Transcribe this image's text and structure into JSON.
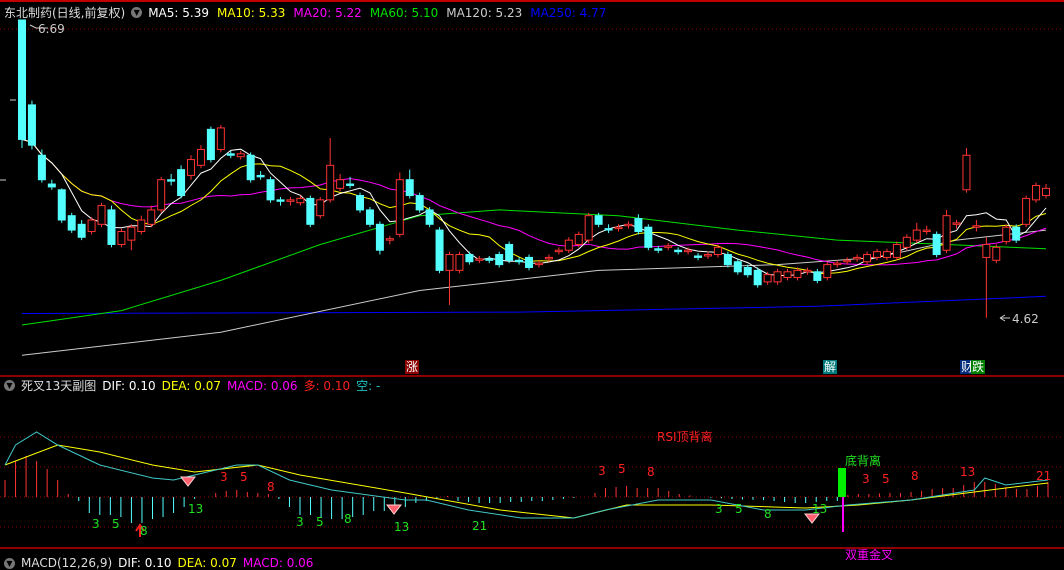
{
  "main_header": {
    "stock": "东北制药(日线,前复权)",
    "ma": [
      {
        "label": "MA5: 5.39",
        "color": "#ffffff"
      },
      {
        "label": "MA10: 5.33",
        "color": "#ffff00"
      },
      {
        "label": "MA20: 5.22",
        "color": "#ff00ff"
      },
      {
        "label": "MA60: 5.10",
        "color": "#00e000"
      },
      {
        "label": "MA120: 5.23",
        "color": "#cccccc"
      },
      {
        "label": "MA250: 4.77",
        "color": "#0000ff"
      }
    ]
  },
  "price_marks": {
    "high": "6.69",
    "low": "4.62"
  },
  "signals": {
    "zhang": "涨",
    "jie": "解",
    "cai": "财",
    "die": "跌"
  },
  "sub_header": {
    "title": "死叉13天副图",
    "dif": "DIF: 0.10",
    "dea": "DEA: 0.07",
    "macd": "MACD: 0.06",
    "duo": "多: 0.10",
    "kong": "空: -"
  },
  "bottom_header": {
    "title": "MACD(12,26,9)",
    "dif": "DIF: 0.10",
    "dea": "DEA: 0.07",
    "macd": "MACD: 0.06"
  },
  "sub_labels": {
    "rsi_top": "RSI顶背离",
    "bottom_div": "底背离",
    "double_gold": "双重金叉",
    "fib": [
      "3",
      "5",
      "8",
      "13",
      "3",
      "5",
      "8",
      "13",
      "21",
      "3",
      "5",
      "8",
      "13",
      "3",
      "5",
      "8",
      "3",
      "5",
      "8",
      "3",
      "5",
      "8",
      "13",
      "21"
    ]
  },
  "colors": {
    "up": "#ff3333",
    "down": "#54ffff",
    "grid": "#a00000"
  },
  "chart_data": {
    "type": "candlestick",
    "candles": [
      [
        6.69,
        5.86,
        6.69,
        5.8
      ],
      [
        6.1,
        5.82,
        6.13,
        5.79
      ],
      [
        5.75,
        5.58,
        5.79,
        5.56
      ],
      [
        5.55,
        5.53,
        5.58,
        5.51
      ],
      [
        5.51,
        5.3,
        5.52,
        5.28
      ],
      [
        5.33,
        5.23,
        5.35,
        5.21
      ],
      [
        5.27,
        5.18,
        5.3,
        5.16
      ],
      [
        5.22,
        5.3,
        5.32,
        5.2
      ],
      [
        5.27,
        5.4,
        5.42,
        5.25
      ],
      [
        5.37,
        5.13,
        5.4,
        5.11
      ],
      [
        5.13,
        5.22,
        5.24,
        5.11
      ],
      [
        5.16,
        5.25,
        5.27,
        5.09
      ],
      [
        5.22,
        5.3,
        5.33,
        5.2
      ],
      [
        5.27,
        5.37,
        5.4,
        5.25
      ],
      [
        5.37,
        5.58,
        5.6,
        5.35
      ],
      [
        5.58,
        5.57,
        5.62,
        5.54
      ],
      [
        5.65,
        5.47,
        5.68,
        5.45
      ],
      [
        5.61,
        5.72,
        5.75,
        5.58
      ],
      [
        5.68,
        5.79,
        5.82,
        5.66
      ],
      [
        5.93,
        5.72,
        5.95,
        5.7
      ],
      [
        5.79,
        5.94,
        5.96,
        5.77
      ],
      [
        5.76,
        5.75,
        5.78,
        5.73
      ],
      [
        5.74,
        5.76,
        5.78,
        5.72
      ],
      [
        5.75,
        5.58,
        5.77,
        5.56
      ],
      [
        5.61,
        5.6,
        5.64,
        5.58
      ],
      [
        5.58,
        5.44,
        5.6,
        5.42
      ],
      [
        5.44,
        5.43,
        5.46,
        5.4
      ],
      [
        5.43,
        5.44,
        5.46,
        5.4
      ],
      [
        5.42,
        5.45,
        5.47,
        5.4
      ],
      [
        5.45,
        5.27,
        5.47,
        5.25
      ],
      [
        5.33,
        5.44,
        5.46,
        5.31
      ],
      [
        5.44,
        5.68,
        5.87,
        5.42
      ],
      [
        5.52,
        5.58,
        5.62,
        5.5
      ],
      [
        5.55,
        5.54,
        5.6,
        5.52
      ],
      [
        5.47,
        5.37,
        5.49,
        5.35
      ],
      [
        5.37,
        5.27,
        5.39,
        5.25
      ],
      [
        5.27,
        5.09,
        5.29,
        5.06
      ],
      [
        5.16,
        5.17,
        5.19,
        5.13
      ],
      [
        5.2,
        5.58,
        5.63,
        5.18
      ],
      [
        5.58,
        5.47,
        5.65,
        5.45
      ],
      [
        5.47,
        5.37,
        5.49,
        5.35
      ],
      [
        5.37,
        5.27,
        5.39,
        5.25
      ],
      [
        5.23,
        4.95,
        5.25,
        4.93
      ],
      [
        4.95,
        5.06,
        5.08,
        4.71
      ],
      [
        4.95,
        5.06,
        5.08,
        4.93
      ],
      [
        5.06,
        5.01,
        5.08,
        4.99
      ],
      [
        5.02,
        5.03,
        5.05,
        5.0
      ],
      [
        5.03,
        5.02,
        5.05,
        5.0
      ],
      [
        5.06,
        4.99,
        5.08,
        4.97
      ],
      [
        5.13,
        5.02,
        5.15,
        5.0
      ],
      [
        5.02,
        5.01,
        5.04,
        4.99
      ],
      [
        5.04,
        4.97,
        5.06,
        4.95
      ],
      [
        4.99,
        5.0,
        5.02,
        4.97
      ],
      [
        5.03,
        5.04,
        5.06,
        5.01
      ],
      [
        5.08,
        5.09,
        5.11,
        5.06
      ],
      [
        5.09,
        5.16,
        5.18,
        5.07
      ],
      [
        5.13,
        5.2,
        5.22,
        5.11
      ],
      [
        5.16,
        5.33,
        5.35,
        5.14
      ],
      [
        5.33,
        5.27,
        5.35,
        5.25
      ],
      [
        5.24,
        5.23,
        5.27,
        5.21
      ],
      [
        5.24,
        5.25,
        5.27,
        5.22
      ],
      [
        5.26,
        5.27,
        5.29,
        5.24
      ],
      [
        5.31,
        5.22,
        5.34,
        5.2
      ],
      [
        5.25,
        5.11,
        5.27,
        5.09
      ],
      [
        5.1,
        5.09,
        5.12,
        5.07
      ],
      [
        5.11,
        5.12,
        5.14,
        5.09
      ],
      [
        5.09,
        5.08,
        5.11,
        5.06
      ],
      [
        5.08,
        5.09,
        5.11,
        5.06
      ],
      [
        5.05,
        5.04,
        5.07,
        5.02
      ],
      [
        5.05,
        5.06,
        5.08,
        5.03
      ],
      [
        5.06,
        5.11,
        5.13,
        5.04
      ],
      [
        5.06,
        4.99,
        5.08,
        4.97
      ],
      [
        5.01,
        4.94,
        5.03,
        4.92
      ],
      [
        4.97,
        4.92,
        4.99,
        4.9
      ],
      [
        4.95,
        4.85,
        4.97,
        4.83
      ],
      [
        4.87,
        4.92,
        4.94,
        4.85
      ],
      [
        4.87,
        4.94,
        4.96,
        4.85
      ],
      [
        4.9,
        4.94,
        4.96,
        4.88
      ],
      [
        4.9,
        4.95,
        4.97,
        4.88
      ],
      [
        4.94,
        4.95,
        4.97,
        4.92
      ],
      [
        4.94,
        4.88,
        4.96,
        4.86
      ],
      [
        4.9,
        4.99,
        5.01,
        4.88
      ],
      [
        4.99,
        5.0,
        5.02,
        4.97
      ],
      [
        5.01,
        5.02,
        5.04,
        4.99
      ],
      [
        5.03,
        5.04,
        5.06,
        5.01
      ],
      [
        5.01,
        5.06,
        5.08,
        4.99
      ],
      [
        5.04,
        5.08,
        5.1,
        5.02
      ],
      [
        5.04,
        5.08,
        5.1,
        5.02
      ],
      [
        5.04,
        5.13,
        5.15,
        5.02
      ],
      [
        5.11,
        5.18,
        5.2,
        5.09
      ],
      [
        5.16,
        5.23,
        5.28,
        5.14
      ],
      [
        5.22,
        5.23,
        5.26,
        5.2
      ],
      [
        5.2,
        5.06,
        5.22,
        5.04
      ],
      [
        5.09,
        5.33,
        5.37,
        5.07
      ],
      [
        5.27,
        5.28,
        5.3,
        5.24
      ],
      [
        5.51,
        5.75,
        5.8,
        5.49
      ],
      [
        5.25,
        5.26,
        5.3,
        5.22
      ],
      [
        5.04,
        5.13,
        5.18,
        4.62
      ],
      [
        5.02,
        5.11,
        5.13,
        5.0
      ],
      [
        5.15,
        5.25,
        5.27,
        5.13
      ],
      [
        5.25,
        5.16,
        5.27,
        5.14
      ],
      [
        5.27,
        5.45,
        5.47,
        5.25
      ],
      [
        5.44,
        5.54,
        5.56,
        5.42
      ],
      [
        5.47,
        5.52,
        5.55,
        5.45
      ]
    ],
    "ma_long": {
      "MA60": [
        [
          0,
          4.57
        ],
        [
          10,
          4.67
        ],
        [
          20,
          4.88
        ],
        [
          30,
          5.13
        ],
        [
          40,
          5.33
        ],
        [
          48,
          5.37
        ],
        [
          60,
          5.33
        ],
        [
          72,
          5.23
        ],
        [
          82,
          5.16
        ],
        [
          93,
          5.13
        ],
        [
          103,
          5.1
        ]
      ],
      "MA120": [
        [
          0,
          4.36
        ],
        [
          20,
          4.52
        ],
        [
          40,
          4.81
        ],
        [
          58,
          4.95
        ],
        [
          76,
          4.99
        ],
        [
          86,
          5.04
        ],
        [
          94,
          5.16
        ],
        [
          103,
          5.23
        ]
      ],
      "MA250": [
        [
          0,
          4.65
        ],
        [
          50,
          4.66
        ],
        [
          80,
          4.7
        ],
        [
          103,
          4.77
        ]
      ]
    },
    "price_range": [
      4.36,
      6.69
    ],
    "macd": {
      "hist": [
        0.085,
        0.18,
        0.205,
        0.18,
        0.14,
        0.085,
        0.015,
        -0.02,
        -0.08,
        -0.09,
        -0.09,
        -0.1,
        -0.13,
        -0.13,
        -0.11,
        -0.1,
        -0.08,
        -0.05,
        -0.01,
        0.0,
        0.02,
        0.03,
        0.035,
        0.025,
        0.02,
        0.015,
        -0.01,
        -0.05,
        -0.09,
        -0.09,
        -0.1,
        -0.11,
        -0.11,
        -0.1,
        -0.09,
        -0.07,
        -0.07,
        -0.06,
        -0.05,
        -0.03,
        -0.02,
        -0.01,
        0.005,
        -0.02,
        -0.025,
        -0.03,
        -0.03,
        -0.03,
        -0.025,
        -0.025,
        -0.02,
        -0.02,
        -0.015,
        -0.01,
        -0.005,
        0.0,
        0.02,
        0.045,
        0.05,
        0.055,
        0.045,
        0.045,
        0.045,
        0.03,
        0.015,
        0.008,
        0.0,
        -0.004,
        -0.006,
        -0.01,
        -0.012,
        -0.014,
        -0.016,
        -0.02,
        -0.025,
        -0.03,
        -0.03,
        -0.025,
        -0.02,
        -0.02,
        0.01,
        0.015,
        0.015,
        0.018,
        0.02,
        0.02,
        0.025,
        0.03,
        0.04,
        0.045,
        0.045,
        0.06,
        0.075,
        0.075,
        0.065,
        0.05,
        0.04,
        0.04,
        0.055,
        0.075
      ],
      "dif": [
        [
          0,
          0.16
        ],
        [
          1,
          0.26
        ],
        [
          3,
          0.325
        ],
        [
          5,
          0.26
        ],
        [
          9,
          0.16
        ],
        [
          14,
          0.095
        ],
        [
          16,
          0.085
        ],
        [
          18,
          0.11
        ],
        [
          22,
          0.16
        ],
        [
          24,
          0.16
        ],
        [
          27,
          0.085
        ],
        [
          31,
          0.035
        ],
        [
          38,
          -0.015
        ],
        [
          40,
          -0.015
        ],
        [
          44,
          -0.065
        ],
        [
          49,
          -0.105
        ],
        [
          54,
          -0.105
        ],
        [
          57,
          -0.065
        ],
        [
          62,
          -0.015
        ],
        [
          67,
          -0.015
        ],
        [
          72,
          -0.065
        ],
        [
          76,
          -0.065
        ],
        [
          80,
          -0.04
        ],
        [
          86,
          -0.015
        ],
        [
          92,
          0.035
        ],
        [
          93,
          0.095
        ],
        [
          95,
          0.06
        ],
        [
          99,
          0.085
        ]
      ],
      "dea": [
        [
          0,
          0.16
        ],
        [
          5,
          0.26
        ],
        [
          9,
          0.225
        ],
        [
          14,
          0.16
        ],
        [
          18,
          0.125
        ],
        [
          24,
          0.16
        ],
        [
          28,
          0.11
        ],
        [
          38,
          0.02
        ],
        [
          47,
          -0.065
        ],
        [
          54,
          -0.105
        ],
        [
          59,
          -0.04
        ],
        [
          67,
          -0.04
        ],
        [
          76,
          -0.055
        ],
        [
          81,
          -0.04
        ],
        [
          86,
          -0.015
        ],
        [
          95,
          0.045
        ],
        [
          99,
          0.07
        ]
      ]
    }
  }
}
